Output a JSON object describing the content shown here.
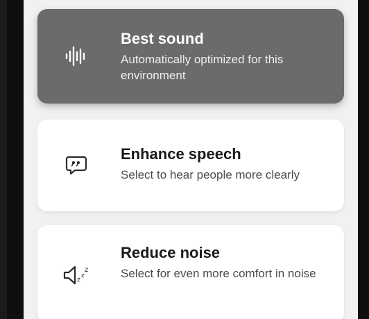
{
  "options": [
    {
      "title": "Best sound",
      "subtitle": "Automatically optimized for this environment",
      "icon": "sound-wave-icon",
      "selected": true
    },
    {
      "title": "Enhance speech",
      "subtitle": "Select to hear people more clearly",
      "icon": "speech-bubble-icon",
      "selected": false
    },
    {
      "title": "Reduce noise",
      "subtitle": "Select for even more comfort in noise",
      "icon": "speaker-quiet-icon",
      "selected": false
    }
  ],
  "colors": {
    "selected_card": "#6b6b6b",
    "card": "#ffffff",
    "background": "#f1f1f1"
  }
}
